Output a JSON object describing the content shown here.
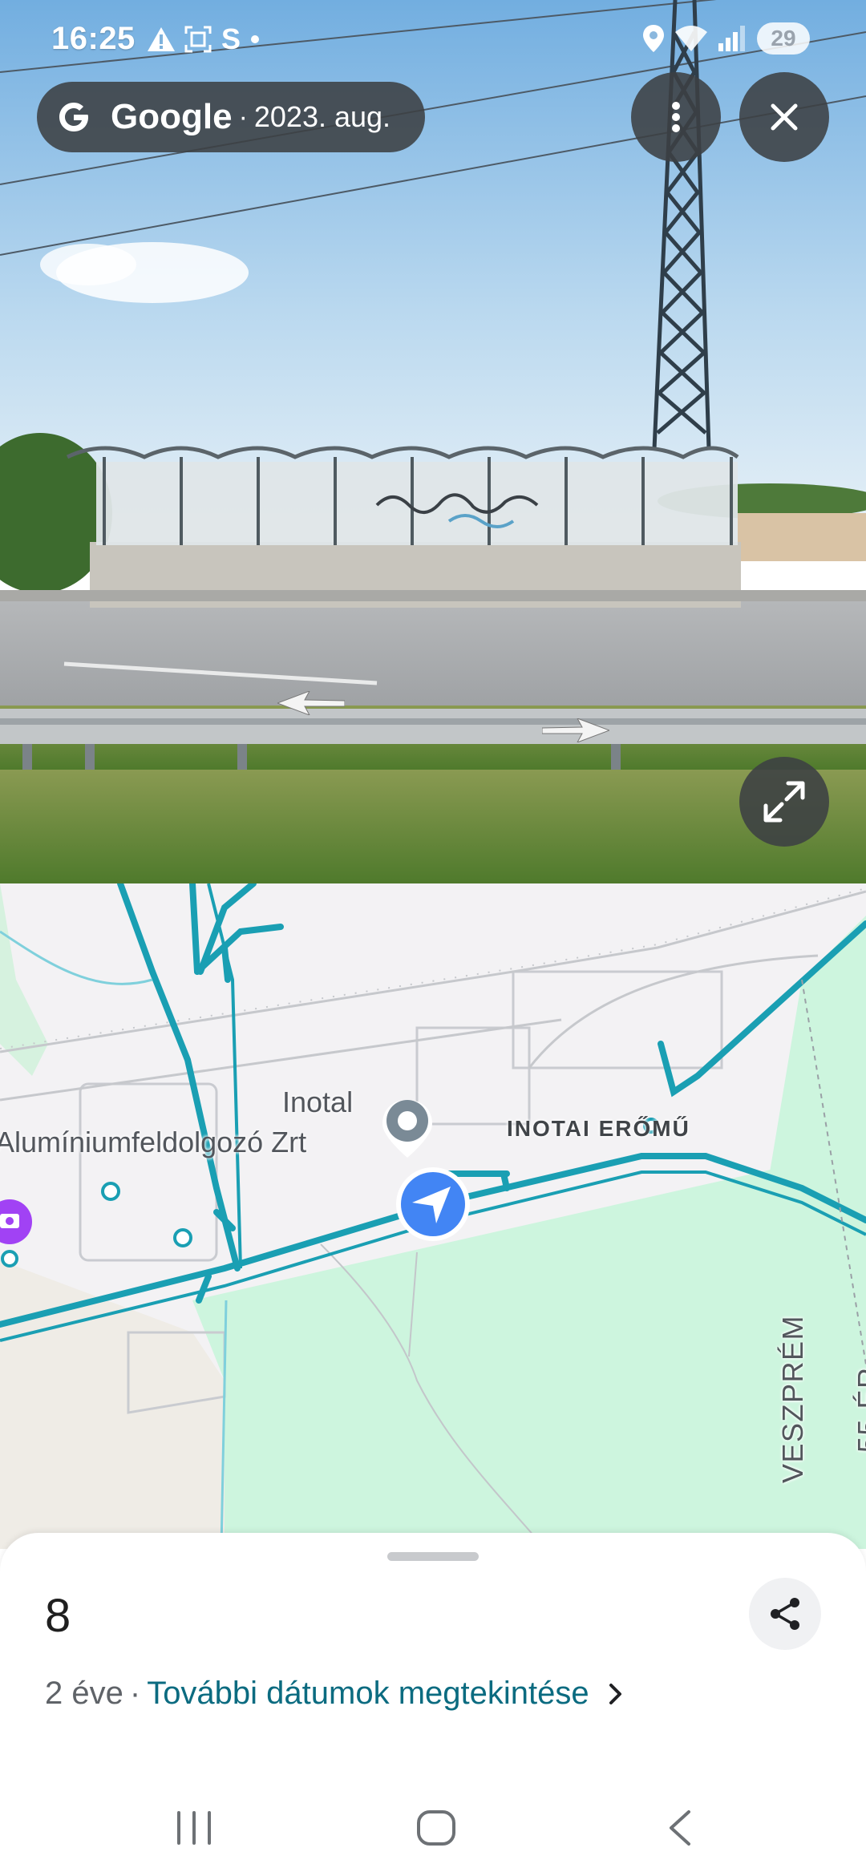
{
  "status_bar": {
    "time": "16:25",
    "left_icons": [
      "warning-icon",
      "screenshot-icon",
      "s-app-icon",
      "dot-icon"
    ],
    "s_label": "S",
    "right_icons": [
      "location-icon",
      "wifi-icon",
      "signal-icon"
    ],
    "battery": "29"
  },
  "streetview": {
    "brand": "Google",
    "separator": "·",
    "date": "2023. aug.",
    "buttons": [
      "more-options",
      "close",
      "expand"
    ]
  },
  "map": {
    "labels": {
      "inotal": "Inotal",
      "aluminium": "Alumíniumfeldolgozó Zrt",
      "inotai_eromu": "INOTAI ERŐMŰ",
      "veszprem": "VESZPRÉM",
      "veszprem_partial": "55 ÉR"
    },
    "colors": {
      "road": "#1a9fb3",
      "green": "#cdf5de",
      "land": "#f3f2f4",
      "arrow": "#4285f4"
    }
  },
  "sheet": {
    "title": "8",
    "age": "2 éve",
    "separator": "·",
    "more_dates_link": "További dátumok megtekintése"
  },
  "nav_bar": {
    "buttons": [
      "recent-apps",
      "home",
      "back"
    ]
  }
}
